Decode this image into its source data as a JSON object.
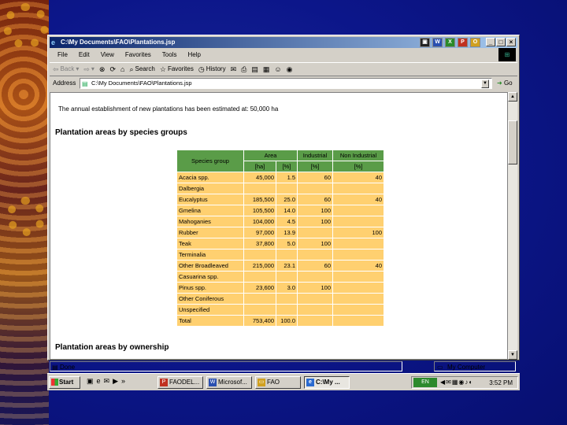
{
  "window": {
    "title": "C:\\My Documents\\FAO\\Plantations.jsp"
  },
  "menu": [
    "File",
    "Edit",
    "View",
    "Favorites",
    "Tools",
    "Help"
  ],
  "toolbar": {
    "back": "Back",
    "search": "Search",
    "favorites": "Favorites",
    "history": "History"
  },
  "address": {
    "label": "Address",
    "value": "C:\\My Documents\\FAO\\Plantations.jsp",
    "go": "Go"
  },
  "page": {
    "intro": "The annual establishment of new plantations has been estimated at: 50,000 ha",
    "heading_species": "Plantation areas by species groups",
    "heading_ownership": "Plantation areas by ownership",
    "table": {
      "headers": {
        "species_group": "Species group",
        "area": "Area",
        "industrial": "Industrial",
        "non_industrial": "Non Industrial",
        "ha": "[ha]",
        "pct": "[%]",
        "ind_pct": "[%]",
        "nonind_pct": "[%]"
      },
      "rows": [
        {
          "group": "Acacia spp.",
          "ha": "45,000",
          "pct": "1.5",
          "ind": "60",
          "nonind": "40"
        },
        {
          "group": "Dalbergia",
          "ha": "",
          "pct": "",
          "ind": "",
          "nonind": ""
        },
        {
          "group": "Eucalyptus",
          "ha": "185,500",
          "pct": "25.0",
          "ind": "60",
          "nonind": "40"
        },
        {
          "group": "Gmelina",
          "ha": "105,500",
          "pct": "14.0",
          "ind": "100",
          "nonind": ""
        },
        {
          "group": "Mahoganies",
          "ha": "104,000",
          "pct": "4.5",
          "ind": "100",
          "nonind": ""
        },
        {
          "group": "Rubber",
          "ha": "97,000",
          "pct": "13.9",
          "ind": "",
          "nonind": "100"
        },
        {
          "group": "Teak",
          "ha": "37,800",
          "pct": "5.0",
          "ind": "100",
          "nonind": ""
        },
        {
          "group": "Terminalia",
          "ha": "",
          "pct": "",
          "ind": "",
          "nonind": ""
        },
        {
          "group": "Other Broadleaved",
          "ha": "215,000",
          "pct": "23.1",
          "ind": "60",
          "nonind": "40"
        },
        {
          "group": "Casuarina spp.",
          "ha": "",
          "pct": "",
          "ind": "",
          "nonind": ""
        },
        {
          "group": "Pinus spp.",
          "ha": "23,600",
          "pct": "3.0",
          "ind": "100",
          "nonind": ""
        },
        {
          "group": "Other Coniferous",
          "ha": "",
          "pct": "",
          "ind": "",
          "nonind": ""
        },
        {
          "group": "Unspecified",
          "ha": "",
          "pct": "",
          "ind": "",
          "nonind": ""
        },
        {
          "group": "Total",
          "ha": "753,400",
          "pct": "100.0",
          "ind": "",
          "nonind": ""
        }
      ]
    }
  },
  "status": {
    "done": "Done",
    "zone": "My Computer"
  },
  "taskbar": {
    "start": "Start",
    "tasks": [
      "FAODEL...",
      "Microsof...",
      "FAO",
      "C:\\My ..."
    ],
    "lang": "EN",
    "clock": "3:52 PM"
  },
  "colors": {
    "header_green": "#5a9c48",
    "cell_orange": "#ffd070",
    "titlebar": "#0a246a"
  }
}
